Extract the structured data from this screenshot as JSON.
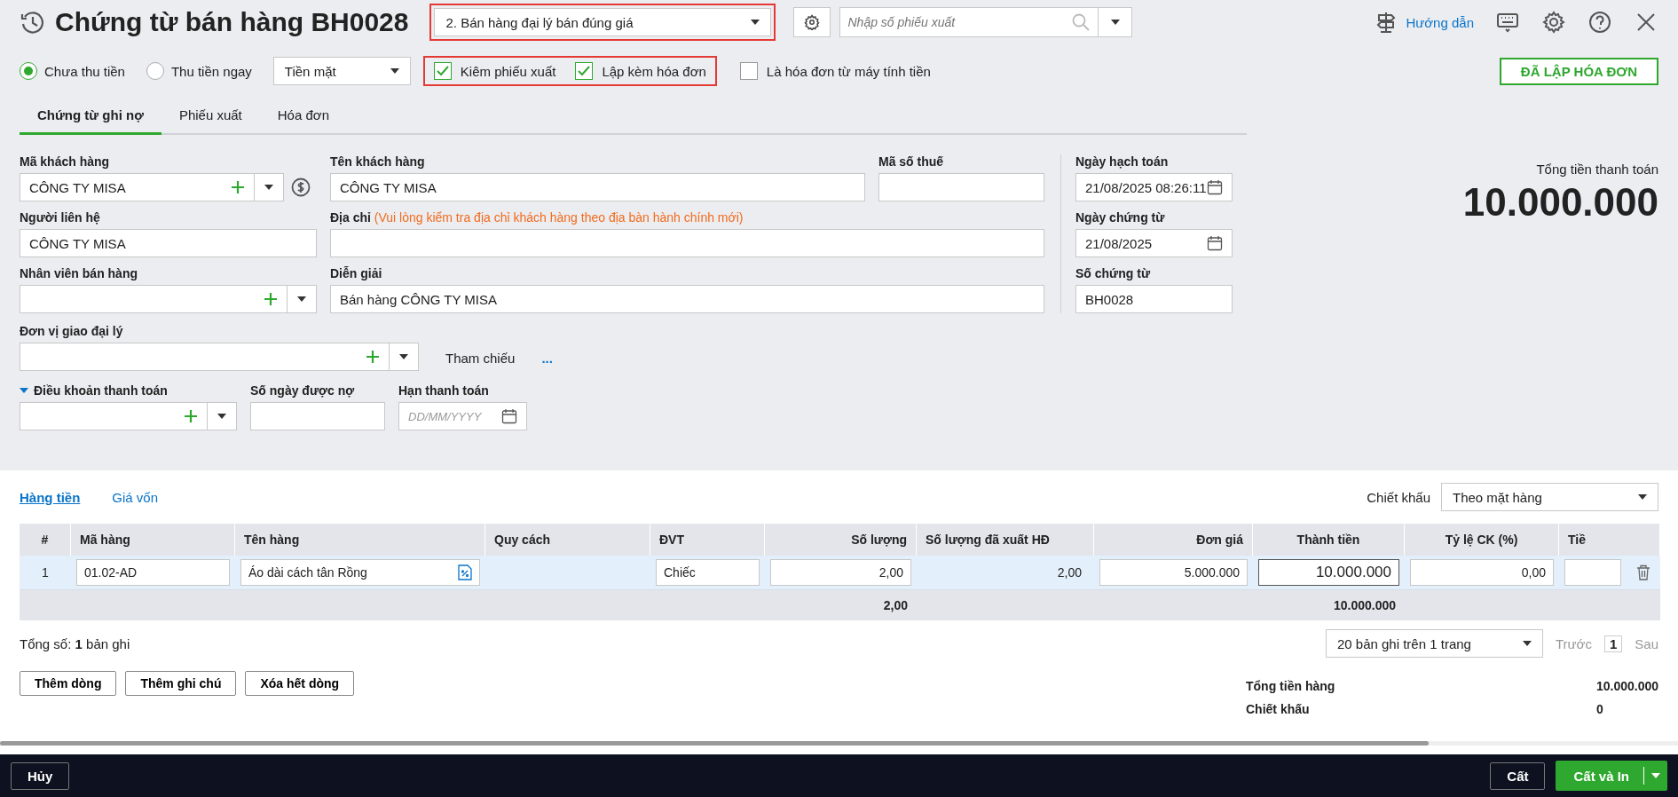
{
  "header": {
    "title": "Chứng từ bán hàng BH0028",
    "type_select": {
      "value": "2. Bán hàng đại lý bán đúng giá",
      "highlighted": true
    },
    "search_placeholder": "Nhập số phiếu xuất",
    "help_link": "Hướng dẫn"
  },
  "payment": {
    "options": [
      {
        "label": "Chưa thu tiền",
        "selected": true
      },
      {
        "label": "Thu tiền ngay",
        "selected": false
      }
    ],
    "method": "Tiền mặt"
  },
  "checkbox_groups": [
    {
      "highlighted": true,
      "items": [
        {
          "label": "Kiêm phiếu xuất",
          "checked": true
        },
        {
          "label": "Lập kèm hóa đơn",
          "checked": true
        }
      ]
    },
    {
      "highlighted": false,
      "items": [
        {
          "label": "Là hóa đơn từ máy tính tiền",
          "checked": false
        }
      ]
    }
  ],
  "status_button": "ĐÃ LẬP HÓA ĐƠN",
  "tabs": [
    {
      "label": "Chứng từ ghi nợ",
      "selected": true
    },
    {
      "label": "Phiếu xuất",
      "selected": false
    },
    {
      "label": "Hóa đơn",
      "selected": false
    }
  ],
  "form": {
    "customer_code": {
      "label": "Mã khách hàng",
      "value": "CÔNG TY MISA"
    },
    "customer_name": {
      "label": "Tên khách hàng",
      "value": "CÔNG TY MISA"
    },
    "tax_code": {
      "label": "Mã số thuế"
    },
    "contact": {
      "label": "Người liên hệ",
      "value": "CÔNG TY MISA"
    },
    "address": {
      "label": "Địa chỉ",
      "note": "(Vui lòng kiểm tra địa chỉ khách hàng theo địa bàn hành chính mới)"
    },
    "salesperson": {
      "label": "Nhân viên bán hàng"
    },
    "description": {
      "label": "Diễn giải",
      "value": "Bán hàng CÔNG TY MISA"
    },
    "agent_unit": {
      "label": "Đơn vị giao đại lý"
    },
    "reference": {
      "label": "Tham chiếu",
      "link": "..."
    },
    "payment_terms": {
      "label": "Điều khoản thanh toán",
      "expanded": true
    },
    "credit_days": {
      "label": "Số ngày được nợ"
    },
    "due_date": {
      "label": "Hạn thanh toán",
      "placeholder": "DD/MM/YYYY"
    },
    "posting_date": {
      "label": "Ngày hạch toán",
      "value": "21/08/2025 08:26:11"
    },
    "voucher_date": {
      "label": "Ngày chứng từ",
      "value": "21/08/2025"
    },
    "voucher_no": {
      "label": "Số chứng từ",
      "value": "BH0028"
    }
  },
  "total": {
    "label": "Tổng tiền thanh toán",
    "value": "10.000.000"
  },
  "detail_tabs": [
    {
      "label": "Hàng tiền",
      "selected": true
    },
    {
      "label": "Giá vốn",
      "selected": false
    }
  ],
  "discount": {
    "label": "Chiết khấu",
    "value": "Theo mặt hàng"
  },
  "table": {
    "columns": [
      "#",
      "Mã hàng",
      "Tên hàng",
      "Quy cách",
      "ĐVT",
      "Số lượng",
      "Số lượng đã xuất HĐ",
      "Đơn giá",
      "Thành tiền",
      "Tỷ lệ CK (%)",
      "Tiề"
    ],
    "rows": [
      {
        "no": "1",
        "code": "01.02-AD",
        "name": "Áo dài cách tân Rồng",
        "unit": "Chiếc",
        "qty": "2,00",
        "invoiced_qty": "2,00",
        "price": "5.000.000",
        "amount": "10.000.000",
        "discount_rate": "0,00"
      }
    ],
    "totals": {
      "qty": "2,00",
      "amount": "10.000.000"
    }
  },
  "record_count": "Tổng số: **1** bản ghi",
  "pager": {
    "page_size": "20 bản ghi trên 1 trang",
    "prev": "Trước",
    "page": "1",
    "next": "Sau"
  },
  "row_buttons": [
    "Thêm dòng",
    "Thêm ghi chú",
    "Xóa hết dòng"
  ],
  "summary": [
    {
      "label": "Tổng tiền hàng",
      "value": "10.000.000"
    },
    {
      "label": "Chiết khấu",
      "value": "0"
    }
  ],
  "footer": {
    "cancel": "Hủy",
    "save": "Cất",
    "save_print": "Cất và In"
  }
}
